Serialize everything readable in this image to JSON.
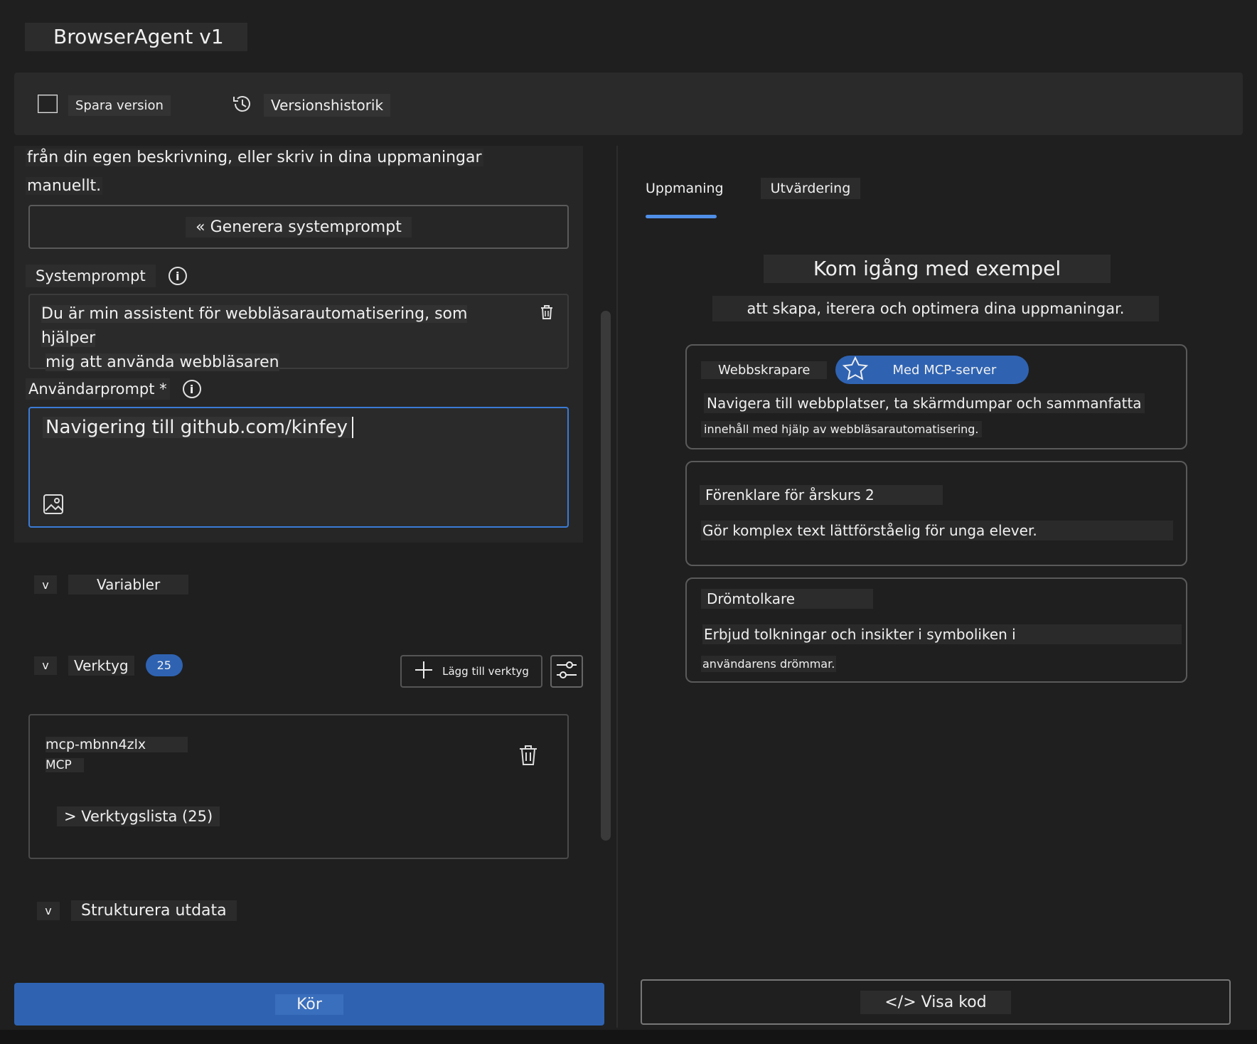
{
  "app": {
    "title": "BrowserAgent v1"
  },
  "toolbar": {
    "save_label": "Spara version",
    "history_label": "Versionshistorik"
  },
  "left": {
    "intro_line1": "från din egen beskrivning, eller skriv in dina uppmaningar",
    "intro_line2": "manuellt.",
    "generate_label": "« Generera systemprompt",
    "system_prompt_label": "Systemprompt",
    "system_prompt_value_line1": "Du är min assistent för webbläsarautomatisering, som hjälper",
    "system_prompt_value_line2": "mig att använda webbläsaren",
    "user_prompt_label": "Användarprompt *",
    "user_prompt_value": "Navigering till github.com/kinfey",
    "variables_label": "Variabler",
    "tools_label": "Verktyg",
    "tools_count": "25",
    "add_tool_label": "Lägg till verktyg",
    "tool": {
      "name": "mcp-mbnn4zlx",
      "type": "MCP",
      "list_label": "> Verktygslista (25)"
    },
    "structured_output_label": "Strukturera utdata",
    "chevron": "v",
    "run_label": "Kör"
  },
  "right": {
    "tabs": [
      {
        "label": "Uppmaning"
      },
      {
        "label": "Utvärdering"
      }
    ],
    "active_tab": "Uppmaning",
    "heading": "Kom igång med exempel",
    "subheading": "att skapa, iterera och optimera dina uppmaningar.",
    "cards": [
      {
        "title": "Webbskrapare",
        "badge": "Med MCP-server",
        "desc_line1": "Navigera till webbplatser, ta skärmdumpar och sammanfatta",
        "desc_line2": "innehåll med hjälp av webbläsarautomatisering."
      },
      {
        "title": "Förenklare för årskurs 2",
        "desc_line1": "Gör komplex text lättförståelig för unga elever."
      },
      {
        "title": "Drömtolkare",
        "desc_line1": "Erbjud tolkningar och insikter i symboliken i",
        "desc_line2": "användarens drömmar."
      }
    ],
    "view_code_label": "</> Visa kod"
  },
  "colors": {
    "accent": "#2f63b2",
    "background": "#1f1f1f",
    "focus_border": "#3b7bd6"
  },
  "icons": [
    "save-icon",
    "history-icon",
    "info-icon",
    "trash-icon",
    "image-icon",
    "plus-icon",
    "sliders-icon",
    "star-icon"
  ]
}
